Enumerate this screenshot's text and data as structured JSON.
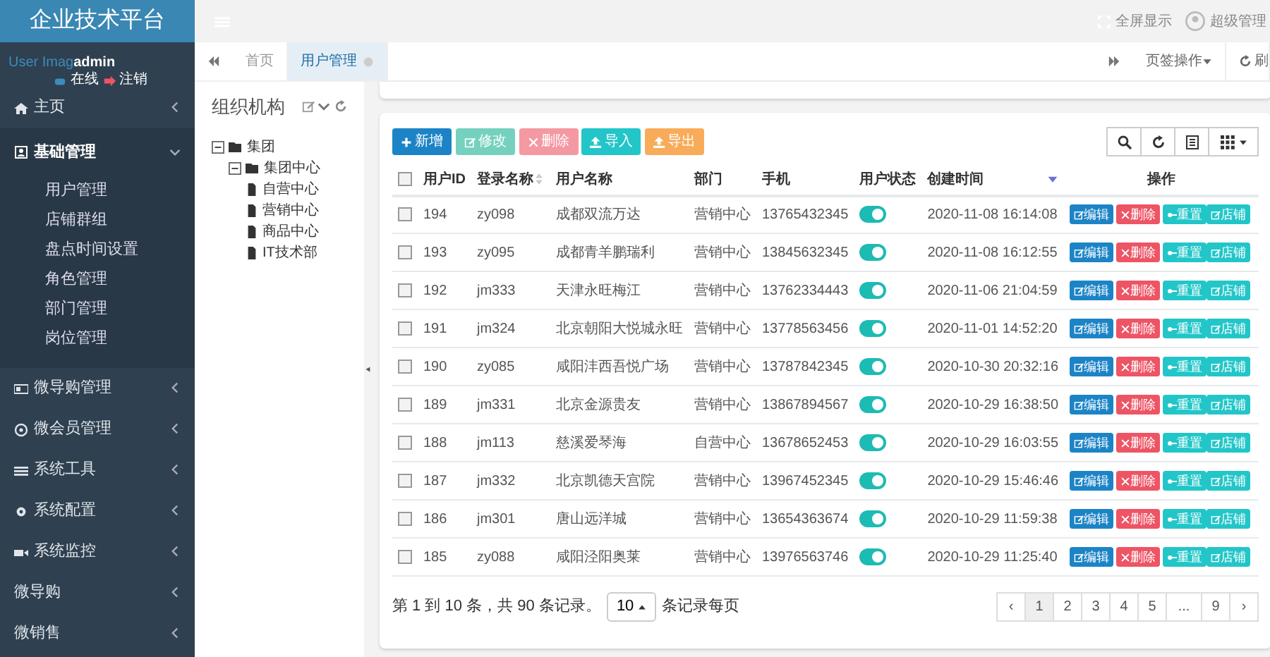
{
  "brand": "企业技术平台",
  "topbar": {
    "fullscreen": "全屏显示",
    "user": "超级管理"
  },
  "user_panel": {
    "image_alt": "User Imag",
    "name": "admin",
    "online": "在线",
    "logout": "注销"
  },
  "sidebar": {
    "items": [
      {
        "label": "主页",
        "expanded": false
      },
      {
        "label": "基础管理",
        "expanded": true,
        "children": [
          {
            "label": "用户管理"
          },
          {
            "label": "店铺群组"
          },
          {
            "label": "盘点时间设置"
          },
          {
            "label": "角色管理"
          },
          {
            "label": "部门管理"
          },
          {
            "label": "岗位管理"
          }
        ]
      },
      {
        "label": "微导购管理",
        "expanded": false
      },
      {
        "label": "微会员管理",
        "expanded": false
      },
      {
        "label": "系统工具",
        "expanded": false
      },
      {
        "label": "系统配置",
        "expanded": false
      },
      {
        "label": "系统监控",
        "expanded": false
      },
      {
        "label": "微导购",
        "expanded": false
      },
      {
        "label": "微销售",
        "expanded": false
      }
    ]
  },
  "tabs": [
    {
      "label": "首页",
      "selected": false
    },
    {
      "label": "用户管理",
      "selected": true
    }
  ],
  "tab_actions": {
    "menu": "页签操作",
    "refresh": "刷"
  },
  "org_panel": {
    "title": "组织机构",
    "tree": [
      {
        "label": "集团",
        "children": [
          {
            "label": "集团中心",
            "children": [
              {
                "label": "自营中心"
              },
              {
                "label": "营销中心"
              },
              {
                "label": "商品中心"
              },
              {
                "label": "IT技术部"
              }
            ]
          }
        ]
      }
    ]
  },
  "toolbar": [
    {
      "label": "新增",
      "kind": "primary",
      "disabled": false
    },
    {
      "label": "修改",
      "kind": "success",
      "disabled": true
    },
    {
      "label": "删除",
      "kind": "danger",
      "disabled": true
    },
    {
      "label": "导入",
      "kind": "info",
      "disabled": false
    },
    {
      "label": "导出",
      "kind": "warning",
      "disabled": false
    }
  ],
  "table": {
    "columns": [
      "用户ID",
      "登录名称",
      "用户名称",
      "部门",
      "手机",
      "用户状态",
      "创建时间",
      "操作"
    ],
    "select_all_checked": false,
    "rows": [
      {
        "id": "194",
        "login": "zy098",
        "name": "成都双流万达",
        "dept": "营销中心",
        "phone": "13765432345",
        "on": true,
        "created": "2020-11-08 16:14:08",
        "checked": false,
        "actions": [
          "编辑",
          "删除",
          "重置",
          "店铺"
        ]
      },
      {
        "id": "193",
        "login": "zy095",
        "name": "成都青羊鹏瑞利",
        "dept": "营销中心",
        "phone": "13845632345",
        "on": true,
        "created": "2020-11-08 16:12:55",
        "checked": false,
        "actions": [
          "编辑",
          "删除",
          "重置",
          "店铺"
        ]
      },
      {
        "id": "192",
        "login": "jm333",
        "name": "天津永旺梅江",
        "dept": "营销中心",
        "phone": "13762334443",
        "on": true,
        "created": "2020-11-06 21:04:59",
        "checked": false,
        "actions": [
          "编辑",
          "删除",
          "重置",
          "店铺"
        ]
      },
      {
        "id": "191",
        "login": "jm324",
        "name": "北京朝阳大悦城永旺",
        "dept": "营销中心",
        "phone": "13778563456",
        "on": true,
        "created": "2020-11-01 14:52:20",
        "checked": false,
        "actions": [
          "编辑",
          "删除",
          "重置",
          "店铺"
        ]
      },
      {
        "id": "190",
        "login": "zy085",
        "name": "咸阳沣西吾悦广场",
        "dept": "营销中心",
        "phone": "13787842345",
        "on": true,
        "created": "2020-10-30 20:32:16",
        "checked": false,
        "actions": [
          "编辑",
          "删除",
          "重置",
          "店铺"
        ]
      },
      {
        "id": "189",
        "login": "jm331",
        "name": "北京金源贵友",
        "dept": "营销中心",
        "phone": "13867894567",
        "on": true,
        "created": "2020-10-29 16:38:50",
        "checked": false,
        "actions": [
          "编辑",
          "删除",
          "重置",
          "店铺"
        ]
      },
      {
        "id": "188",
        "login": "jm113",
        "name": "慈溪爱琴海",
        "dept": "自营中心",
        "phone": "13678652453",
        "on": true,
        "created": "2020-10-29 16:03:55",
        "checked": false,
        "actions": [
          "编辑",
          "删除",
          "重置",
          "店铺"
        ]
      },
      {
        "id": "187",
        "login": "jm332",
        "name": "北京凯德天宫院",
        "dept": "营销中心",
        "phone": "13967452345",
        "on": true,
        "created": "2020-10-29 15:46:46",
        "checked": false,
        "actions": [
          "编辑",
          "删除",
          "重置",
          "店铺"
        ]
      },
      {
        "id": "186",
        "login": "jm301",
        "name": "唐山远洋城",
        "dept": "营销中心",
        "phone": "13654363674",
        "on": true,
        "created": "2020-10-29 11:59:38",
        "checked": false,
        "actions": [
          "编辑",
          "删除",
          "重置",
          "店铺"
        ]
      },
      {
        "id": "185",
        "login": "zy088",
        "name": "咸阳泾阳奥莱",
        "dept": "营销中心",
        "phone": "13976563746",
        "on": true,
        "created": "2020-10-29 11:25:40",
        "checked": false,
        "actions": [
          "编辑",
          "删除",
          "重置",
          "店铺"
        ]
      }
    ]
  },
  "footer": {
    "summary": "第 1 到 10 条，共 90 条记录。",
    "page_size": "10",
    "per_page": "条记录每页",
    "pages": [
      {
        "label": "‹",
        "selected": false
      },
      {
        "label": "1",
        "selected": true
      },
      {
        "label": "2",
        "selected": false
      },
      {
        "label": "3",
        "selected": false
      },
      {
        "label": "4",
        "selected": false
      },
      {
        "label": "5",
        "selected": false
      },
      {
        "label": "...",
        "selected": false
      },
      {
        "label": "9",
        "selected": false
      },
      {
        "label": "›",
        "selected": false
      }
    ]
  }
}
